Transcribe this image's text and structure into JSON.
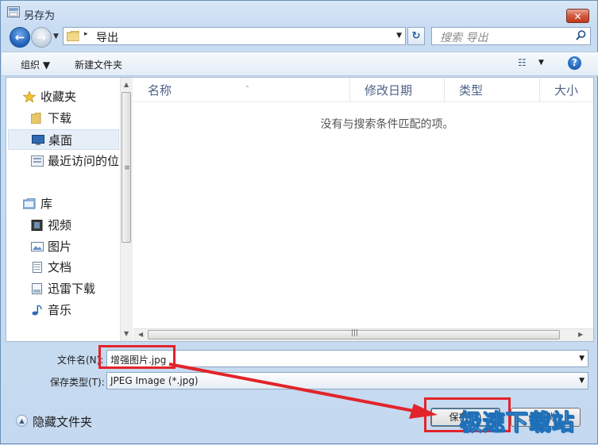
{
  "window": {
    "title": "另存为",
    "close_glyph": "✕"
  },
  "nav": {
    "back_glyph": "←",
    "fwd_glyph": "→",
    "drop_glyph": "▼"
  },
  "address": {
    "sep_glyph": "▸",
    "current": "导出",
    "drop_glyph": "▼"
  },
  "refresh_glyph": "↻",
  "search": {
    "placeholder": "搜索 导出"
  },
  "toolbar": {
    "organize": "组织 ▼",
    "new_folder": "新建文件夹",
    "view_glyph": "☷",
    "view_drop": "▼",
    "help": "?"
  },
  "sidebar": {
    "items": [
      {
        "label": "收藏夹",
        "icon": "star-icon"
      },
      {
        "label": "下载",
        "icon": "download-folder-icon"
      },
      {
        "label": "桌面",
        "icon": "desktop-icon"
      },
      {
        "label": "最近访问的位",
        "icon": "recent-places-icon"
      },
      {
        "label": "库",
        "icon": "library-icon"
      },
      {
        "label": "视频",
        "icon": "video-icon"
      },
      {
        "label": "图片",
        "icon": "pictures-icon"
      },
      {
        "label": "文档",
        "icon": "documents-icon"
      },
      {
        "label": "迅雷下载",
        "icon": "download-folder-icon"
      },
      {
        "label": "音乐",
        "icon": "music-icon"
      }
    ]
  },
  "scroll": {
    "up": "▲",
    "down": "▼",
    "left": "◀",
    "right": "▶",
    "grip_v": "≡",
    "grip_h": "|||",
    "sort_caret": "⌃"
  },
  "columns": [
    "名称",
    "修改日期",
    "类型",
    "大小"
  ],
  "empty_message": "没有与搜索条件匹配的项。",
  "form": {
    "filename_label": "文件名(N):",
    "filename_value": "增强图片.jpg",
    "filetype_label": "保存类型(T):",
    "filetype_value": "JPEG Image (*.jpg)",
    "drop_glyph": "▼"
  },
  "hide_folders": {
    "glyph": "▲",
    "label": "隐藏文件夹"
  },
  "buttons": {
    "save": "保存(S)",
    "cancel": "取消"
  },
  "watermark": "极速下载站",
  "colors": {
    "highlight": "#e2242a",
    "accent": "#1e5fb8"
  }
}
